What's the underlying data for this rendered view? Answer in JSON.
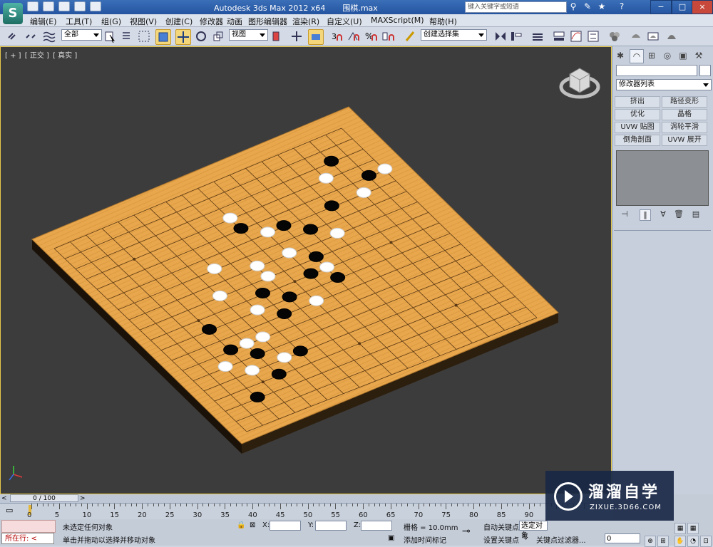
{
  "titlebar": {
    "app": "Autodesk 3ds Max  2012 x64",
    "file": "围棋.max",
    "search_placeholder": "键入关键字或短语",
    "minimize": "−",
    "maximize": "□",
    "close": "×"
  },
  "menu": [
    "编辑(E)",
    "工具(T)",
    "组(G)",
    "视图(V)",
    "创建(C)",
    "修改器",
    "动画",
    "图形编辑器",
    "渲染(R)",
    "自定义(U)",
    "MAXScript(M)",
    "帮助(H)"
  ],
  "toolbar": {
    "selection_filter": "全部",
    "ref_coord": "视图",
    "named_selection": "创建选择集"
  },
  "viewport": {
    "labels": [
      "[ + ]",
      "[ 正交 ]",
      "[ 真实 ]"
    ],
    "board_lines": 19,
    "black_stones": [
      [
        16,
        2
      ],
      [
        14,
        5
      ],
      [
        17,
        4
      ],
      [
        9,
        4
      ],
      [
        11,
        5
      ],
      [
        12,
        6
      ],
      [
        11,
        8
      ],
      [
        10,
        9
      ],
      [
        11,
        10
      ],
      [
        7,
        9
      ],
      [
        8,
        10
      ],
      [
        7,
        11
      ],
      [
        3,
        12
      ],
      [
        4,
        15
      ],
      [
        6,
        14
      ],
      [
        2,
        16
      ],
      [
        4,
        13
      ],
      [
        3,
        10
      ]
    ],
    "white_stones": [
      [
        18,
        4
      ],
      [
        16,
        5
      ],
      [
        15,
        3
      ],
      [
        9,
        3
      ],
      [
        10,
        5
      ],
      [
        13,
        7
      ],
      [
        8,
        7
      ],
      [
        10,
        7
      ],
      [
        11,
        9
      ],
      [
        9,
        11
      ],
      [
        8,
        8
      ],
      [
        6,
        10
      ],
      [
        5,
        12
      ],
      [
        5,
        14
      ],
      [
        4,
        12
      ],
      [
        3,
        14
      ],
      [
        2,
        13
      ],
      [
        5,
        8
      ],
      [
        6,
        6
      ]
    ]
  },
  "command_panel": {
    "modifier_list": "修改器列表",
    "buttons": [
      "挤出",
      "路径变形",
      "优化",
      "晶格",
      "UVW 贴图",
      "涡轮平滑",
      "倒角剖面",
      "UVW 展开"
    ]
  },
  "timeline": {
    "frame_label": "0 / 100",
    "ticks": [
      "0",
      "5",
      "10",
      "15",
      "20",
      "25",
      "30",
      "35",
      "40",
      "45",
      "50",
      "55",
      "60",
      "65",
      "70",
      "75",
      "80",
      "85",
      "90"
    ]
  },
  "status": {
    "selection": "未选定任何对象",
    "prompt": "单击并拖动以选择并移动对象",
    "maxscript_label": "所在行:",
    "x_label": "X:",
    "y_label": "Y:",
    "z_label": "Z:",
    "grid": "栅格 = 10.0mm",
    "add_time_tag": "添加时间标记",
    "auto_key": "自动关键点",
    "set_key": "设置关键点",
    "selected_object": "选定对象",
    "key_filters": "关键点过滤器...",
    "frame_field": "0"
  },
  "watermark": {
    "brand": "溜溜自学",
    "url": "ZIXUE.3D66.COM"
  },
  "colors": {
    "board_top": "#e9a94f",
    "board_line": "#5a3814",
    "viewport_bg": "#3c3c3c",
    "active_border": "#e7c84a"
  }
}
